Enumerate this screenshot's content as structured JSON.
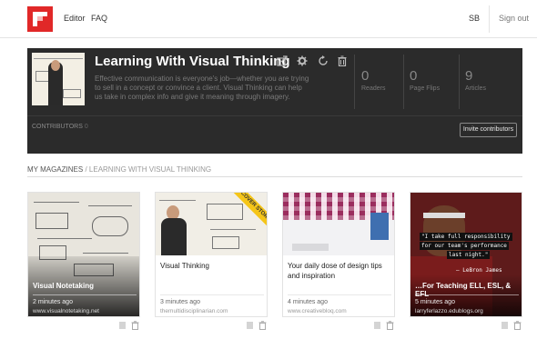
{
  "nav": {
    "editor": "Editor",
    "faq": "FAQ",
    "user": "SB",
    "signout": "Sign out"
  },
  "magazine": {
    "title": "Learning With Visual Thinking",
    "description": "Effective communication is everyone's job—whether you are trying to sell in a concept or convince a client. Visual Thinking can help us take in complex info and give it meaning through imagery.",
    "stats": [
      {
        "value": "0",
        "label": "Readers"
      },
      {
        "value": "0",
        "label": "Page Flips"
      },
      {
        "value": "9",
        "label": "Articles"
      }
    ],
    "contributors_label": "CONTRIBUTORS",
    "contributors_count": "0",
    "invite_label": "Invite contributors"
  },
  "breadcrumb": {
    "root": "MY MAGAZINES",
    "sep": "/",
    "current": "LEARNING WITH VISUAL THINKING"
  },
  "cards": [
    {
      "title": "Visual Notetaking",
      "time": "2 minutes ago",
      "source": "www.visualnotetaking.net"
    },
    {
      "title": "Visual Thinking",
      "time": "3 minutes ago",
      "source": "themultidisciplinarian.com",
      "ribbon": "COVER STORY"
    },
    {
      "title": "Your daily dose of design tips and inspiration",
      "time": "4 minutes ago",
      "source": "www.creativebloq.com"
    },
    {
      "title": "…For Teaching ELL, ESL, & EFL",
      "time": "5 minutes ago",
      "source": "larryferlazzo.edublogs.org",
      "quote": [
        "\"I take full responsibility",
        "for our team's performance",
        "last night.\""
      ],
      "quote_author": "— LeBron James"
    }
  ],
  "colors": {
    "brand_red": "#e12828",
    "panel_bg": "#2b2b2b"
  }
}
